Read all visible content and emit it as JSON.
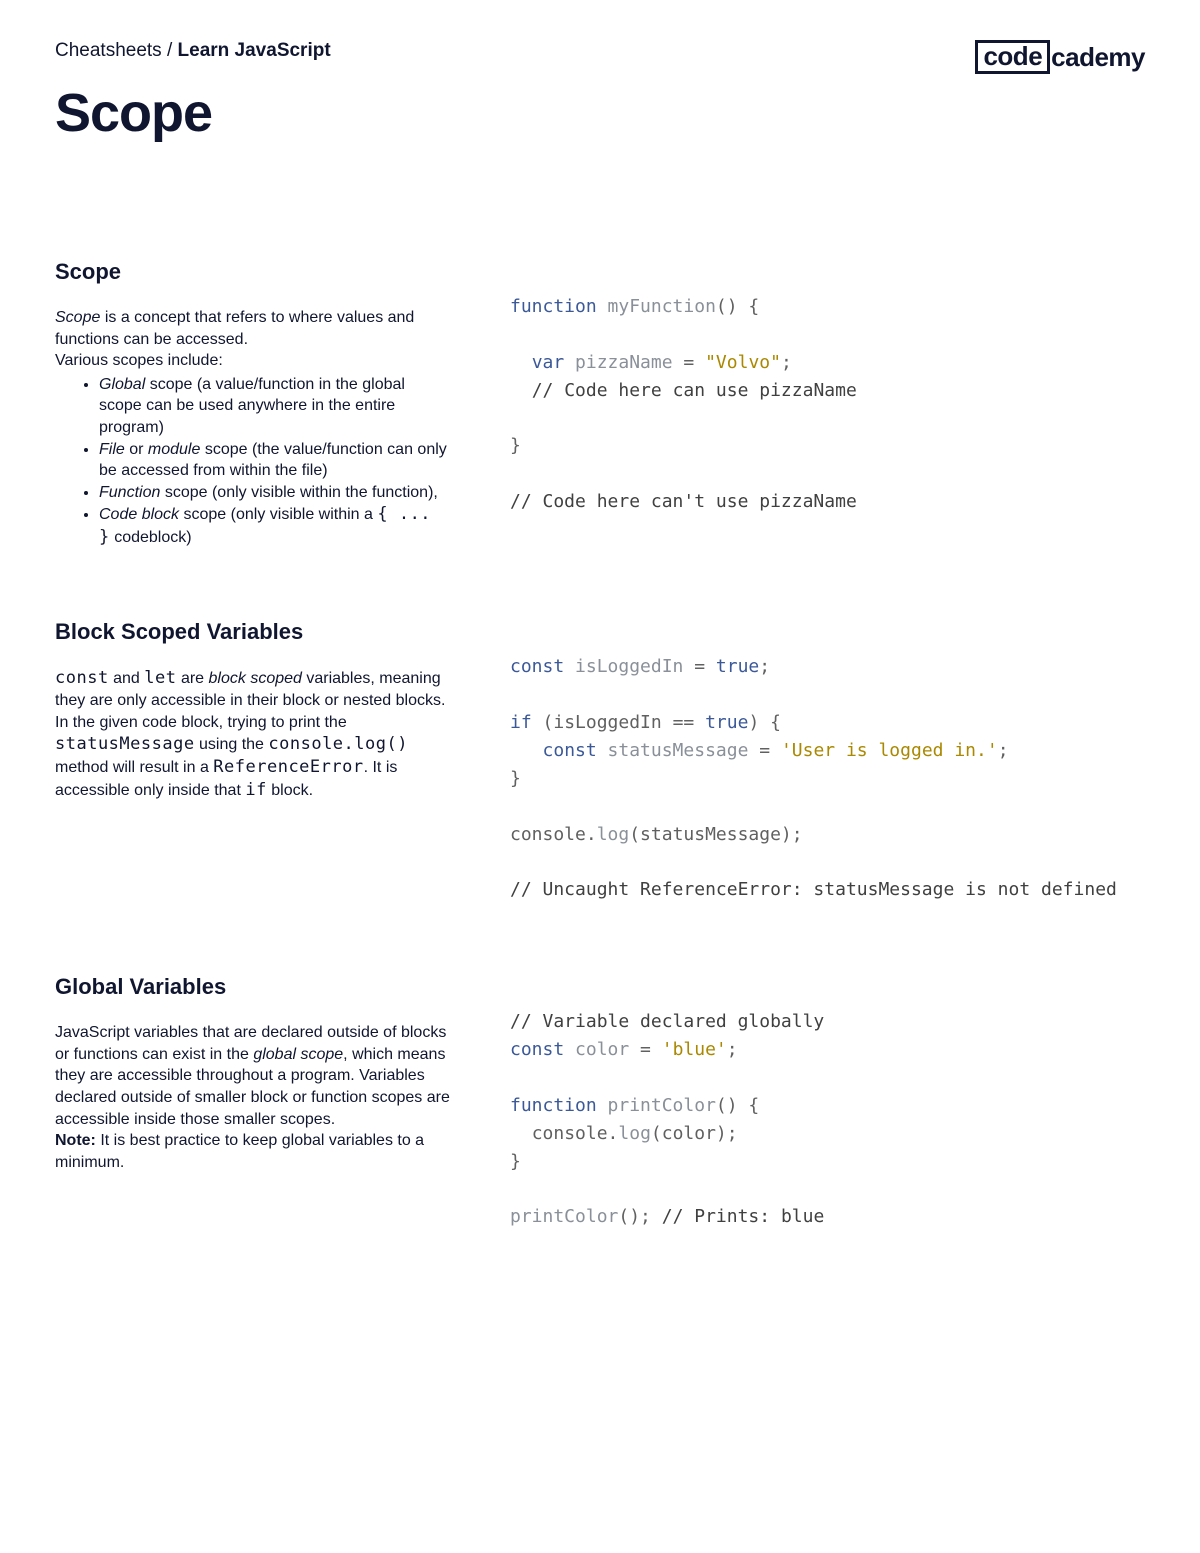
{
  "breadcrumb": {
    "part1": "Cheatsheets / ",
    "part2": "Learn JavaScript"
  },
  "logo": {
    "left": "code",
    "right": "cademy"
  },
  "page_title": "Scope",
  "sections": {
    "scope": {
      "heading": "Scope",
      "p1_italic": "Scope",
      "p1_rest": " is a concept that refers to where values and functions can be accessed.",
      "p2": "Various scopes include:",
      "li1_italic": "Global",
      "li1_rest": " scope (a value/function in the global scope can be used anywhere in the entire program)",
      "li2_i1": "File",
      "li2_mid": " or ",
      "li2_i2": "module",
      "li2_rest": " scope (the value/function can only be accessed from within the file)",
      "li3_italic": "Function",
      "li3_rest": " scope (only visible within the function),",
      "li4_italic": "Code block",
      "li4_rest1": " scope (only visible within a ",
      "li4_code": "{ ... }",
      "li4_rest2": " codeblock)",
      "code": {
        "l1a": "function",
        "l1b": " myFunction",
        "l1c": "() {",
        "l3a": "  var",
        "l3b": " pizzaName",
        "l3c": " = ",
        "l3d": "\"Volvo\"",
        "l3e": ";",
        "l4": "  // Code here can use pizzaName",
        "l6": "}",
        "l8": "// Code here can't use pizzaName"
      }
    },
    "block": {
      "heading": "Block Scoped Variables",
      "c1": "const",
      "t1": " and ",
      "c2": "let",
      "t2": " are ",
      "i1": "block scoped",
      "t3": " variables, meaning they are only accessible in their block or nested blocks. In the given code block, trying to print the ",
      "c3": "statusMessage",
      "t4": " using the ",
      "c4": "console.log()",
      "t5": " method will result in a ",
      "c5": "ReferenceError",
      "t6": ". It is accessible only inside that ",
      "c6": "if",
      "t7": " block.",
      "code": {
        "l1a": "const",
        "l1b": " isLoggedIn",
        "l1c": " = ",
        "l1d": "true",
        "l1e": ";",
        "l3a": "if",
        "l3b": " (isLoggedIn == ",
        "l3c": "true",
        "l3d": ") {",
        "l4a": "   const",
        "l4b": " statusMessage",
        "l4c": " = ",
        "l4d": "'User is logged in.'",
        "l4e": ";",
        "l5": "}",
        "l7a": "console.",
        "l7b": "log",
        "l7c": "(statusMessage);",
        "l9": "// Uncaught ReferenceError: statusMessage is not defined"
      }
    },
    "global": {
      "heading": "Global Variables",
      "p1a": "JavaScript variables that are declared outside of blocks or functions can exist in the ",
      "p1_i": "global scope",
      "p1b": ", which means they are accessible throughout a program. Variables declared outside of smaller block or function scopes are accessible inside those smaller scopes.",
      "p2_bold": "Note:",
      "p2_rest": " It is best practice to keep global variables to a minimum.",
      "code": {
        "l1": "// Variable declared globally",
        "l2a": "const",
        "l2b": " color",
        "l2c": " = ",
        "l2d": "'blue'",
        "l2e": ";",
        "l4a": "function",
        "l4b": " printColor",
        "l4c": "() {",
        "l5a": "  console.",
        "l5b": "log",
        "l5c": "(color);",
        "l6": "}",
        "l8a": "printColor",
        "l8b": "(); ",
        "l8c": "// Prints: blue"
      }
    }
  }
}
